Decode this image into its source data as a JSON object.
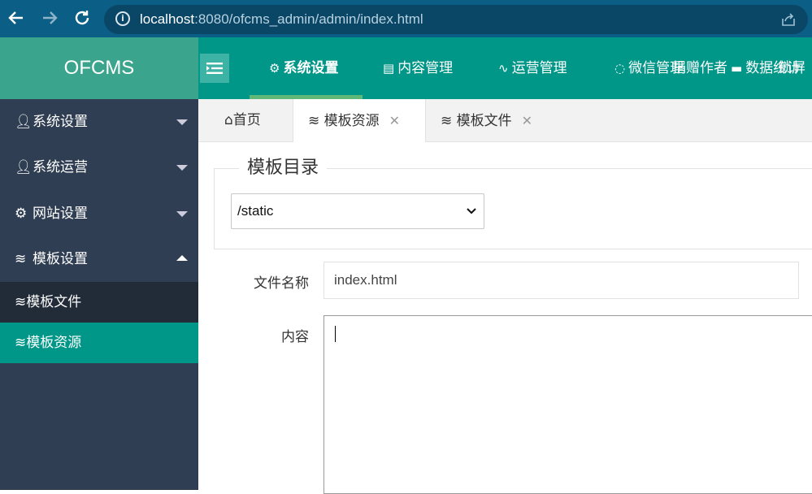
{
  "browser": {
    "url_host": "localhost",
    "url_path": ":8080/ofcms_admin/admin/index.html",
    "icons": [
      "back-arrow-icon",
      "forward-arrow-icon",
      "reload-icon",
      "info-icon",
      "share-icon"
    ]
  },
  "app": {
    "logo": "OFCMS",
    "top_nav": [
      {
        "label": "系统设置",
        "icon": "gear-icon",
        "active": true
      },
      {
        "label": "内容管理",
        "icon": "clipboard-icon"
      },
      {
        "label": "运营管理",
        "icon": "pulse-icon"
      },
      {
        "label": "微信管理",
        "icon": "chat-icon"
      },
      {
        "label": "捐赠作者",
        "icon": ""
      },
      {
        "label": "数据统计",
        "icon": "monitor-icon"
      },
      {
        "label": "锁屏",
        "icon": ""
      }
    ]
  },
  "sidebar": {
    "items": [
      {
        "label": "系统设置",
        "icon": "user-icon",
        "expanded": false
      },
      {
        "label": "系统运营",
        "icon": "user-icon",
        "expanded": false
      },
      {
        "label": "网站设置",
        "icon": "gear-icon",
        "expanded": false
      },
      {
        "label": "模板设置",
        "icon": "layers-icon",
        "expanded": true
      }
    ],
    "sub_items": [
      {
        "label": "模板文件",
        "icon": "layers-icon",
        "active": false
      },
      {
        "label": "模板资源",
        "icon": "layers-icon",
        "active": true
      }
    ]
  },
  "tabs": [
    {
      "label": "首页",
      "icon": "home-icon",
      "closable": false
    },
    {
      "label": "模板资源",
      "icon": "layers-icon",
      "closable": true,
      "active": true
    },
    {
      "label": "模板文件",
      "icon": "layers-icon",
      "closable": true
    }
  ],
  "form": {
    "legend": "模板目录",
    "directory_value": "/static",
    "file_name_label": "文件名称",
    "file_name_value": "index.html",
    "content_label": "内容"
  },
  "colors": {
    "browser_bar": "#0b5f86",
    "header": "#009688",
    "logo_bg": "#3aa58c",
    "sidebar": "#2f3e52",
    "sidebar_active": "#009688",
    "sidebar_sub_bg": "#222b38"
  }
}
